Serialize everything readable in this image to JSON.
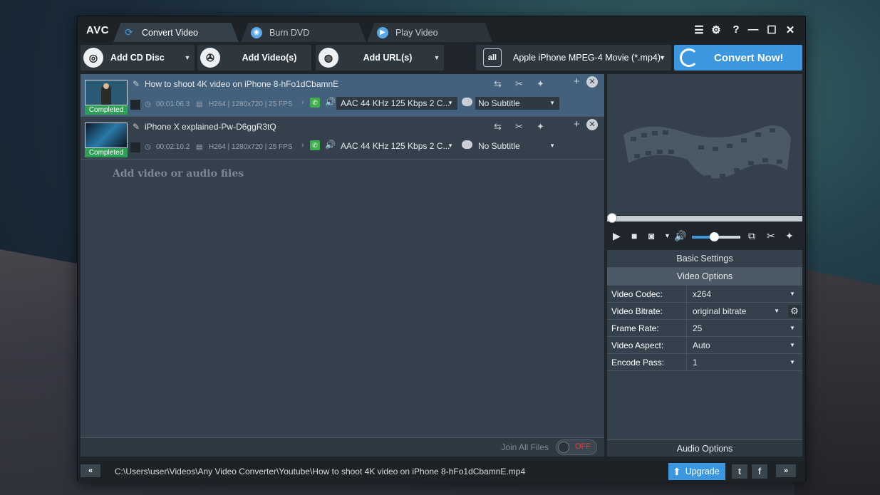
{
  "app": {
    "logo": "AVC"
  },
  "tabs": [
    {
      "label": "Convert Video",
      "active": true
    },
    {
      "label": "Burn DVD",
      "active": false
    },
    {
      "label": "Play Video",
      "active": false
    }
  ],
  "window_controls": {
    "question": "?"
  },
  "toolbar": {
    "add_cd": "Add CD Disc",
    "add_videos": "Add Video(s)",
    "add_url": "Add URL(s)",
    "profile_icon_text": "all",
    "profile": "Apple iPhone MPEG-4 Movie (*.mp4)",
    "convert": "Convert Now!"
  },
  "files": [
    {
      "name": "How to shoot 4K video on iPhone 8-hFo1dCbamnE",
      "status": "Completed",
      "duration": "00:01:06.3",
      "video_info": "H264 | 1280x720 | 25 FPS",
      "audio": "AAC 44 KHz 125 Kbps 2 C...",
      "subtitle": "No Subtitle"
    },
    {
      "name": "iPhone X explained-Pw-D6ggR3tQ",
      "status": "Completed",
      "duration": "00:02:10.2",
      "video_info": "H264 | 1280x720 | 25 FPS",
      "audio": "AAC 44 KHz 125 Kbps 2 C...",
      "subtitle": "No Subtitle"
    }
  ],
  "filelist": {
    "add_hint": "Add video or audio files"
  },
  "join": {
    "label": "Join All Files",
    "toggle": "OFF"
  },
  "player": {
    "volume_level": 0.45
  },
  "settings": {
    "basic": "Basic Settings",
    "video_options": "Video Options",
    "rows": [
      {
        "key": "Video Codec:",
        "value": "x264"
      },
      {
        "key": "Video Bitrate:",
        "value": "original bitrate"
      },
      {
        "key": "Frame Rate:",
        "value": "25"
      },
      {
        "key": "Video Aspect:",
        "value": "Auto"
      },
      {
        "key": "Encode Pass:",
        "value": "1"
      }
    ],
    "audio_options": "Audio Options"
  },
  "statusbar": {
    "path": "C:\\Users\\user\\Videos\\Any Video Converter\\Youtube\\How to shoot 4K video on iPhone 8-hFo1dCbamnE.mp4",
    "upgrade": "Upgrade",
    "collapse": "«",
    "expand": "»"
  },
  "colors": {
    "accent": "#3a97e0",
    "completed": "#2e9f57",
    "selected_row": "#43607d"
  }
}
